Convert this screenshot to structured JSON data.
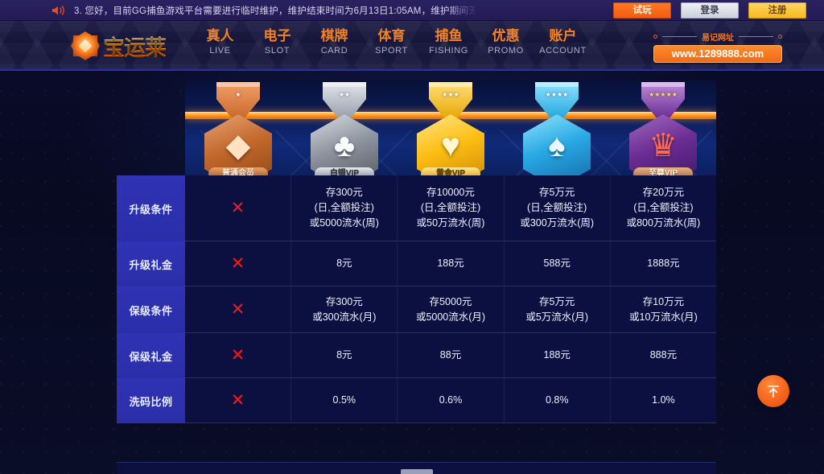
{
  "notice": {
    "icon": "speaker-icon",
    "text": "3.  您好，目前GG捕鱼游戏平台需要进行临时维护，维护结束时间为6月13日1:05AM，维护期间无"
  },
  "top_buttons": {
    "try": "试玩",
    "login": "登录",
    "register": "注册"
  },
  "header": {
    "logo_text": "宝运莱",
    "nav": [
      {
        "cn": "真人",
        "en": "LIVE"
      },
      {
        "cn": "电子",
        "en": "SLOT"
      },
      {
        "cn": "棋牌",
        "en": "CARD"
      },
      {
        "cn": "体育",
        "en": "SPORT"
      },
      {
        "cn": "捕鱼",
        "en": "FISHING"
      },
      {
        "cn": "优惠",
        "en": "PROMO"
      },
      {
        "cn": "账户",
        "en": "ACCOUNT"
      }
    ],
    "url_caption": "易记网址",
    "url_value": "www.1289888.com"
  },
  "vip_levels": [
    {
      "name": "普通会员",
      "stars": "★",
      "glyph": "◆",
      "tier": "bronze"
    },
    {
      "name": "白银VIP",
      "stars": "★★",
      "glyph": "♣",
      "tier": "silver"
    },
    {
      "name": "黄金VIP",
      "stars": "★★★",
      "glyph": "♥",
      "tier": "gold"
    },
    {
      "name": "",
      "stars": "★★★★",
      "glyph": "♠",
      "tier": "diamond"
    },
    {
      "name": "至尊VIP",
      "stars": "★★★★★",
      "glyph": "♛",
      "tier": "supreme"
    }
  ],
  "table": {
    "rows": [
      {
        "label": "升级条件",
        "cells": [
          {
            "type": "cross",
            "lines": [
              "✕"
            ]
          },
          {
            "type": "text",
            "lines": [
              "存300元",
              "(日,全额投注)",
              "或5000流水(周)"
            ]
          },
          {
            "type": "text",
            "lines": [
              "存10000元",
              "(日,全额投注)",
              "或50万流水(周)"
            ]
          },
          {
            "type": "text",
            "lines": [
              "存5万元",
              "(日,全额投注)",
              "或300万流水(周)"
            ]
          },
          {
            "type": "text",
            "lines": [
              "存20万元",
              "(日,全额投注)",
              "或800万流水(周)"
            ]
          }
        ]
      },
      {
        "label": "升级礼金",
        "cells": [
          {
            "type": "cross",
            "lines": [
              "✕"
            ]
          },
          {
            "type": "text",
            "lines": [
              "8元"
            ]
          },
          {
            "type": "text",
            "lines": [
              "188元"
            ]
          },
          {
            "type": "text",
            "lines": [
              "588元"
            ]
          },
          {
            "type": "text",
            "lines": [
              "1888元"
            ]
          }
        ]
      },
      {
        "label": "保级条件",
        "cells": [
          {
            "type": "cross",
            "lines": [
              "✕"
            ]
          },
          {
            "type": "text",
            "lines": [
              "存300元",
              "或300流水(月)"
            ]
          },
          {
            "type": "text",
            "lines": [
              "存5000元",
              "或5000流水(月)"
            ]
          },
          {
            "type": "text",
            "lines": [
              "存5万元",
              "或5万流水(月)"
            ]
          },
          {
            "type": "text",
            "lines": [
              "存10万元",
              "或10万流水(月)"
            ]
          }
        ]
      },
      {
        "label": "保级礼金",
        "cells": [
          {
            "type": "cross",
            "lines": [
              "✕"
            ]
          },
          {
            "type": "text",
            "lines": [
              "8元"
            ]
          },
          {
            "type": "text",
            "lines": [
              "88元"
            ]
          },
          {
            "type": "text",
            "lines": [
              "188元"
            ]
          },
          {
            "type": "text",
            "lines": [
              "888元"
            ]
          }
        ]
      },
      {
        "label": "洗码比例",
        "cells": [
          {
            "type": "cross",
            "lines": [
              "✕"
            ]
          },
          {
            "type": "text",
            "lines": [
              "0.5%"
            ]
          },
          {
            "type": "text",
            "lines": [
              "0.6%"
            ]
          },
          {
            "type": "text",
            "lines": [
              "0.8%"
            ]
          },
          {
            "type": "text",
            "lines": [
              "1.0%"
            ]
          }
        ]
      }
    ]
  },
  "scroll_top": {
    "icon": "arrow-up-icon"
  },
  "colors": {
    "accent_orange": "#f4601a",
    "nav_orange": "#f58220",
    "header_blue": "#2f33b4",
    "table_bg": "#0c1040",
    "cross_red": "#ee1d24",
    "register_yellow": "#f5b81d"
  }
}
